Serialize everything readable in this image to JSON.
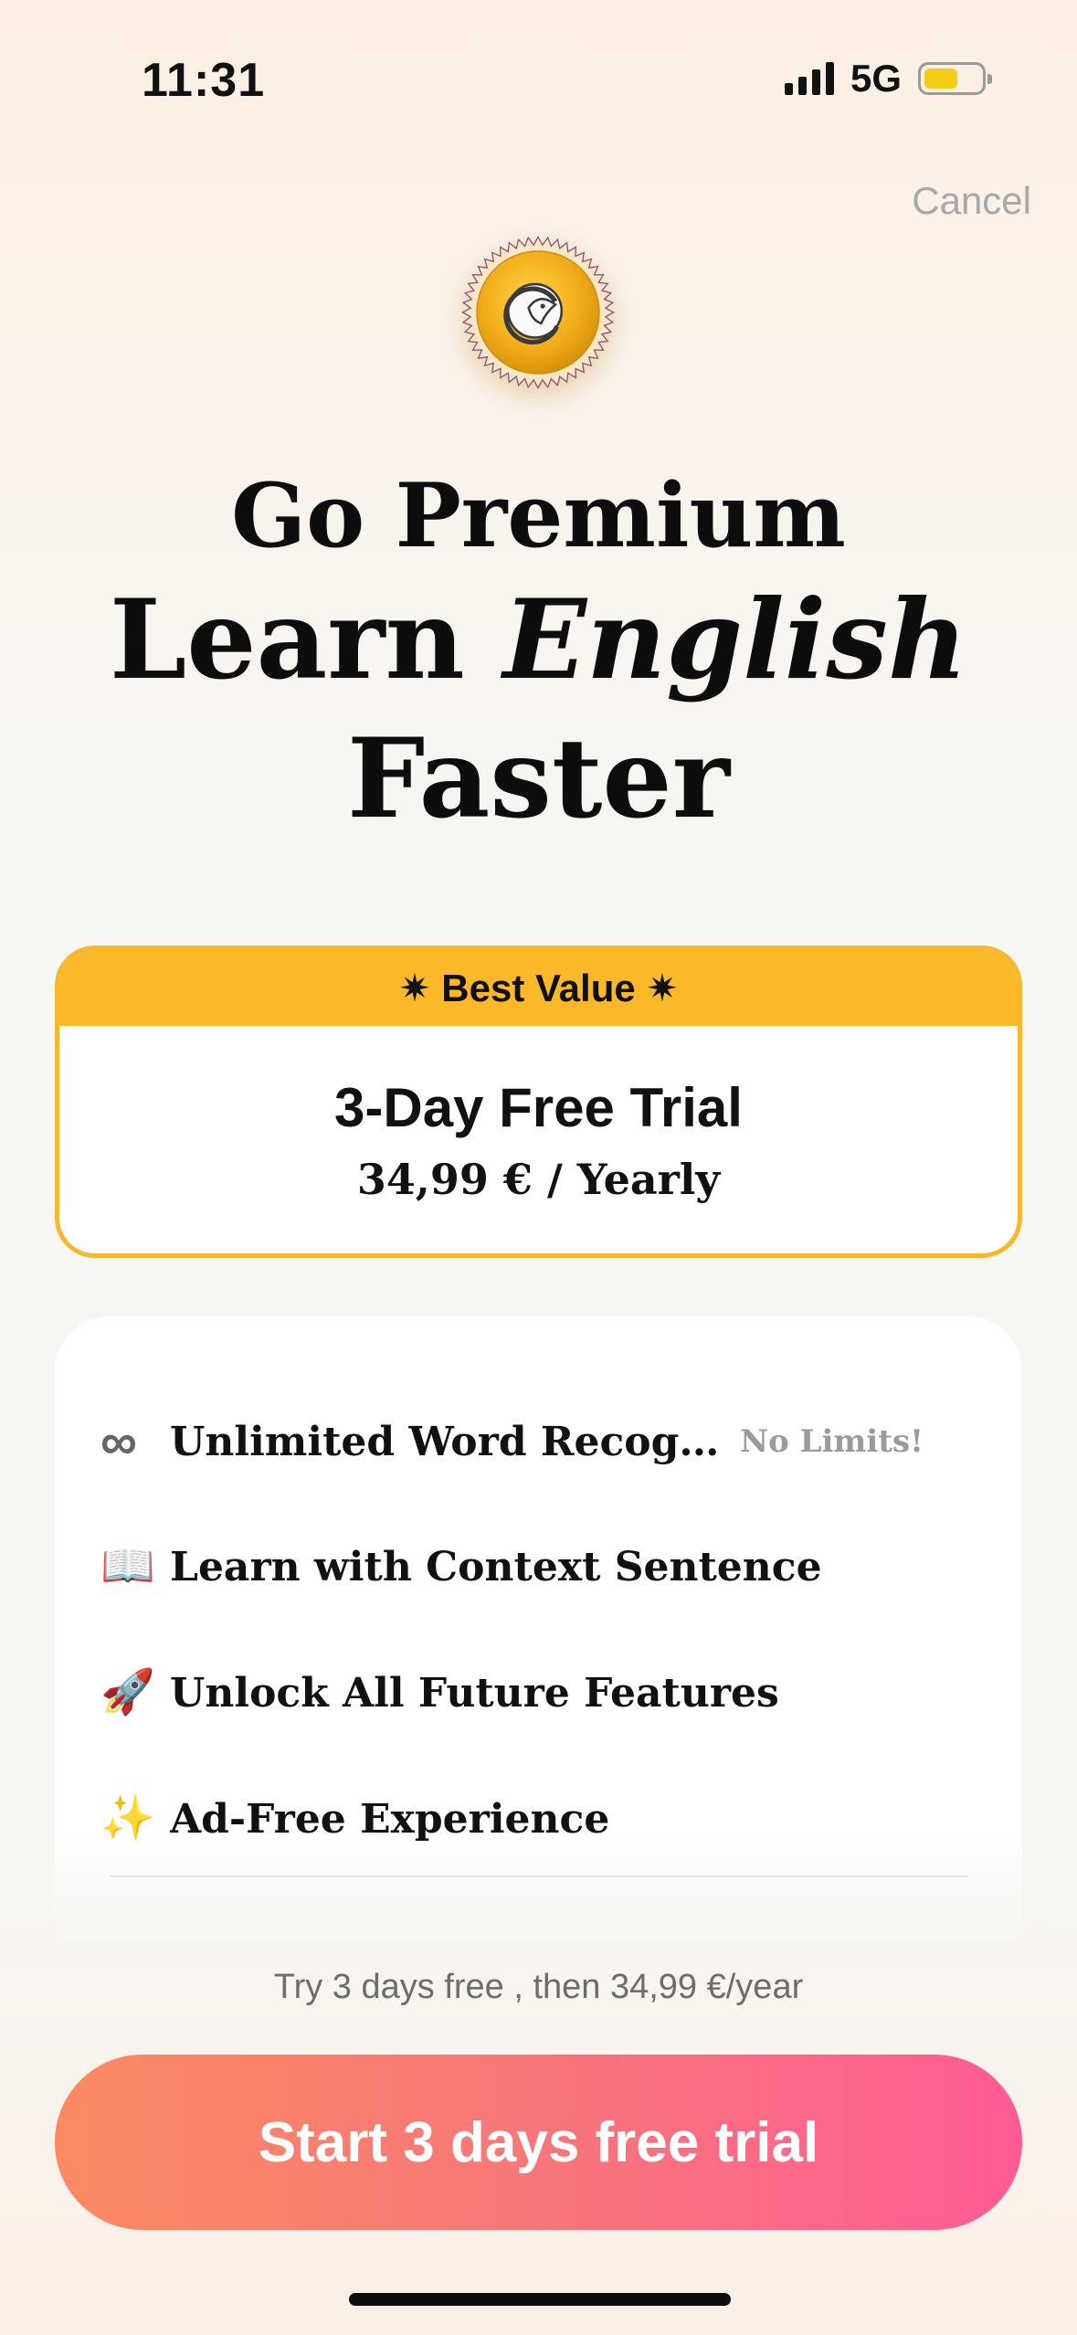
{
  "status_bar": {
    "time": "11:31",
    "network": "5G",
    "battery_level": 0.6,
    "battery_color": "#f5cc16"
  },
  "header": {
    "cancel_label": "Cancel",
    "logo_icon": "seal-badge-icon"
  },
  "hero": {
    "line1": "Go Premium",
    "line2_part1": "Learn ",
    "line2_italic": "English",
    "line3": "Faster"
  },
  "plan": {
    "badge": "✷ Best Value ✷",
    "title": "3-Day Free Trial",
    "price": "34,99 € / Yearly",
    "accent_color": "#fbb828"
  },
  "features": {
    "items": [
      {
        "icon": "∞",
        "icon_name": "infinity-icon",
        "label": "Unlimited Word Recognition",
        "note": "No Limits!"
      },
      {
        "icon": "📖",
        "icon_name": "book-icon",
        "label": "Learn with Context Sentence"
      },
      {
        "icon": "🚀",
        "icon_name": "rocket-icon",
        "label": "Unlock All Future Features"
      },
      {
        "icon": "✨",
        "icon_name": "sparkles-icon",
        "label": "Ad-Free Experience"
      }
    ]
  },
  "footer": {
    "terms": "Try 3 days free , then 34,99 €/year",
    "cta_label": "Start 3 days free trial",
    "cta_gradient": [
      "#fb8a63",
      "#ff5b95"
    ]
  }
}
